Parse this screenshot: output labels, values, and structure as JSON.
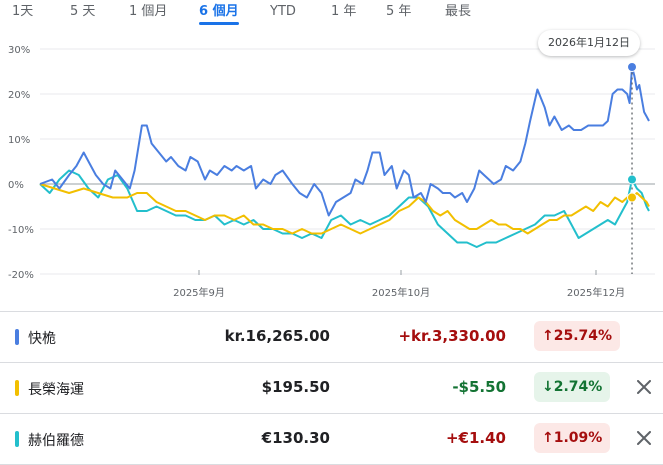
{
  "tabs": [
    {
      "label": "1天",
      "active": false
    },
    {
      "label": "5 天",
      "active": false
    },
    {
      "label": "1 個月",
      "active": false
    },
    {
      "label": "6 個月",
      "active": true
    },
    {
      "label": "YTD",
      "active": false
    },
    {
      "label": "1 年",
      "active": false
    },
    {
      "label": "5 年",
      "active": false
    },
    {
      "label": "最長",
      "active": false
    }
  ],
  "tooltip": {
    "date": "2026年1月12日"
  },
  "rows": [
    {
      "name": "快桅",
      "price": "kr.16,265.00",
      "change": "+kr.3,330.00",
      "pct": "↑25.74%",
      "direction": "up",
      "color": "#4a7ee0",
      "removable": false
    },
    {
      "name": "長榮海運",
      "price": "$195.50",
      "change": "-$5.50",
      "pct": "↓2.74%",
      "direction": "down",
      "color": "#f2bf00",
      "removable": true
    },
    {
      "name": "赫伯羅德",
      "price": "€130.30",
      "change": "+€1.40",
      "pct": "↑1.09%",
      "direction": "up",
      "color": "#23bfcc",
      "removable": true
    }
  ],
  "icons": {
    "close": "close-icon",
    "arrow_up": "arrow-up-icon",
    "arrow_down": "arrow-down-icon"
  },
  "chart_data": {
    "type": "line",
    "y_ticks": [
      "30%",
      "20%",
      "10%",
      "0%",
      "-10%",
      "-20%"
    ],
    "x_ticks": [
      "2025年9月",
      "2025年10月",
      "2025年12月"
    ],
    "ylim": [
      -20,
      30
    ],
    "unit": "percent change",
    "series": [
      {
        "name": "快桅",
        "color": "#4a7ee0",
        "points": [
          [
            0,
            0
          ],
          [
            5,
            1
          ],
          [
            8,
            -1
          ],
          [
            12,
            2
          ],
          [
            15,
            4
          ],
          [
            18,
            7
          ],
          [
            20,
            5
          ],
          [
            23,
            2
          ],
          [
            26,
            0
          ],
          [
            29,
            -1
          ],
          [
            31,
            3
          ],
          [
            34,
            1
          ],
          [
            37,
            -1
          ],
          [
            39,
            3
          ],
          [
            42,
            13
          ],
          [
            44,
            13
          ],
          [
            46,
            9
          ],
          [
            49,
            7
          ],
          [
            52,
            5
          ],
          [
            54,
            6
          ],
          [
            57,
            4
          ],
          [
            60,
            3
          ],
          [
            62,
            6
          ],
          [
            65,
            5
          ],
          [
            68,
            1
          ],
          [
            70,
            3
          ],
          [
            73,
            2
          ],
          [
            76,
            4
          ],
          [
            79,
            3
          ],
          [
            81,
            4
          ],
          [
            84,
            3
          ],
          [
            87,
            4
          ],
          [
            89,
            -1
          ],
          [
            92,
            1
          ],
          [
            95,
            0
          ],
          [
            97,
            2
          ],
          [
            100,
            3
          ],
          [
            104,
            0
          ],
          [
            107,
            -2
          ],
          [
            110,
            -3
          ],
          [
            113,
            0
          ],
          [
            116,
            -2
          ],
          [
            119,
            -7
          ],
          [
            122,
            -4
          ],
          [
            125,
            -3
          ],
          [
            128,
            -2
          ],
          [
            130,
            1
          ],
          [
            133,
            0
          ],
          [
            135,
            3
          ],
          [
            137,
            7
          ],
          [
            140,
            7
          ],
          [
            142,
            2
          ],
          [
            145,
            4
          ],
          [
            147,
            -1
          ],
          [
            150,
            3
          ],
          [
            152,
            2
          ],
          [
            154,
            -3
          ],
          [
            157,
            -2
          ],
          [
            159,
            -4
          ],
          [
            161,
            0
          ],
          [
            164,
            -1
          ],
          [
            166,
            -2
          ],
          [
            169,
            -2
          ],
          [
            171,
            -3
          ],
          [
            174,
            -2
          ],
          [
            176,
            -4
          ],
          [
            179,
            -1
          ],
          [
            181,
            3
          ],
          [
            183,
            2
          ],
          [
            185,
            1
          ],
          [
            187,
            0
          ],
          [
            190,
            1
          ],
          [
            192,
            4
          ],
          [
            195,
            3
          ],
          [
            198,
            5
          ],
          [
            200,
            9
          ],
          [
            202,
            14
          ],
          [
            205,
            21
          ],
          [
            208,
            17
          ],
          [
            210,
            13
          ],
          [
            212,
            15
          ],
          [
            215,
            12
          ],
          [
            218,
            13
          ],
          [
            220,
            12
          ],
          [
            223,
            12
          ],
          [
            226,
            13
          ],
          [
            229,
            13
          ],
          [
            232,
            13
          ],
          [
            234,
            14
          ],
          [
            236,
            20
          ],
          [
            238,
            21
          ],
          [
            240,
            21
          ],
          [
            242,
            20
          ],
          [
            243,
            18
          ],
          [
            244,
            26
          ],
          [
            245,
            24
          ],
          [
            246,
            21
          ],
          [
            247,
            22
          ],
          [
            248,
            19
          ],
          [
            249,
            16
          ],
          [
            250,
            15
          ],
          [
            251,
            14
          ]
        ]
      },
      {
        "name": "長榮海運",
        "color": "#f2bf00",
        "points": [
          [
            0,
            0
          ],
          [
            6,
            -1
          ],
          [
            12,
            -2
          ],
          [
            18,
            -1
          ],
          [
            24,
            -2
          ],
          [
            30,
            -3
          ],
          [
            36,
            -3
          ],
          [
            40,
            -2
          ],
          [
            44,
            -2
          ],
          [
            48,
            -4
          ],
          [
            52,
            -5
          ],
          [
            56,
            -6
          ],
          [
            60,
            -6
          ],
          [
            64,
            -7
          ],
          [
            68,
            -8
          ],
          [
            72,
            -7
          ],
          [
            76,
            -7
          ],
          [
            80,
            -8
          ],
          [
            84,
            -7
          ],
          [
            88,
            -9
          ],
          [
            92,
            -9
          ],
          [
            96,
            -10
          ],
          [
            100,
            -10
          ],
          [
            104,
            -11
          ],
          [
            108,
            -10
          ],
          [
            112,
            -11
          ],
          [
            116,
            -11
          ],
          [
            120,
            -10
          ],
          [
            124,
            -9
          ],
          [
            128,
            -10
          ],
          [
            132,
            -11
          ],
          [
            136,
            -10
          ],
          [
            140,
            -9
          ],
          [
            144,
            -8
          ],
          [
            148,
            -6
          ],
          [
            152,
            -5
          ],
          [
            156,
            -3
          ],
          [
            159,
            -4
          ],
          [
            162,
            -6
          ],
          [
            165,
            -7
          ],
          [
            168,
            -6
          ],
          [
            171,
            -8
          ],
          [
            174,
            -9
          ],
          [
            177,
            -10
          ],
          [
            180,
            -10
          ],
          [
            183,
            -9
          ],
          [
            186,
            -8
          ],
          [
            189,
            -9
          ],
          [
            192,
            -9
          ],
          [
            195,
            -10
          ],
          [
            198,
            -10
          ],
          [
            201,
            -11
          ],
          [
            204,
            -10
          ],
          [
            207,
            -9
          ],
          [
            210,
            -8
          ],
          [
            213,
            -8
          ],
          [
            216,
            -7
          ],
          [
            219,
            -7
          ],
          [
            222,
            -6
          ],
          [
            225,
            -5
          ],
          [
            228,
            -6
          ],
          [
            231,
            -4
          ],
          [
            234,
            -5
          ],
          [
            237,
            -3
          ],
          [
            240,
            -4
          ],
          [
            242,
            -3
          ],
          [
            244,
            -3
          ],
          [
            246,
            -2
          ],
          [
            248,
            -3
          ],
          [
            250,
            -4
          ],
          [
            251,
            -5
          ]
        ]
      },
      {
        "name": "赫伯羅德",
        "color": "#23bfcc",
        "points": [
          [
            0,
            0
          ],
          [
            4,
            -2
          ],
          [
            8,
            1
          ],
          [
            12,
            3
          ],
          [
            16,
            2
          ],
          [
            20,
            -1
          ],
          [
            24,
            -3
          ],
          [
            28,
            1
          ],
          [
            32,
            2
          ],
          [
            36,
            -1
          ],
          [
            40,
            -6
          ],
          [
            44,
            -6
          ],
          [
            48,
            -5
          ],
          [
            52,
            -6
          ],
          [
            56,
            -7
          ],
          [
            60,
            -7
          ],
          [
            64,
            -8
          ],
          [
            68,
            -8
          ],
          [
            72,
            -7
          ],
          [
            76,
            -9
          ],
          [
            80,
            -8
          ],
          [
            84,
            -9
          ],
          [
            88,
            -8
          ],
          [
            92,
            -10
          ],
          [
            96,
            -10
          ],
          [
            100,
            -11
          ],
          [
            104,
            -11
          ],
          [
            108,
            -12
          ],
          [
            112,
            -11
          ],
          [
            116,
            -12
          ],
          [
            120,
            -8
          ],
          [
            124,
            -7
          ],
          [
            128,
            -9
          ],
          [
            132,
            -8
          ],
          [
            136,
            -9
          ],
          [
            140,
            -8
          ],
          [
            144,
            -7
          ],
          [
            148,
            -5
          ],
          [
            152,
            -3
          ],
          [
            156,
            -3
          ],
          [
            160,
            -5
          ],
          [
            164,
            -9
          ],
          [
            168,
            -11
          ],
          [
            172,
            -13
          ],
          [
            176,
            -13
          ],
          [
            180,
            -14
          ],
          [
            184,
            -13
          ],
          [
            188,
            -13
          ],
          [
            192,
            -12
          ],
          [
            196,
            -11
          ],
          [
            200,
            -10
          ],
          [
            204,
            -9
          ],
          [
            208,
            -7
          ],
          [
            212,
            -7
          ],
          [
            216,
            -6
          ],
          [
            219,
            -9
          ],
          [
            222,
            -12
          ],
          [
            225,
            -11
          ],
          [
            228,
            -10
          ],
          [
            231,
            -9
          ],
          [
            234,
            -8
          ],
          [
            237,
            -9
          ],
          [
            240,
            -6
          ],
          [
            242,
            -4
          ],
          [
            244,
            1
          ],
          [
            246,
            -1
          ],
          [
            248,
            -2
          ],
          [
            250,
            -5
          ],
          [
            251,
            -6
          ]
        ]
      }
    ],
    "highlight_index": 244
  }
}
